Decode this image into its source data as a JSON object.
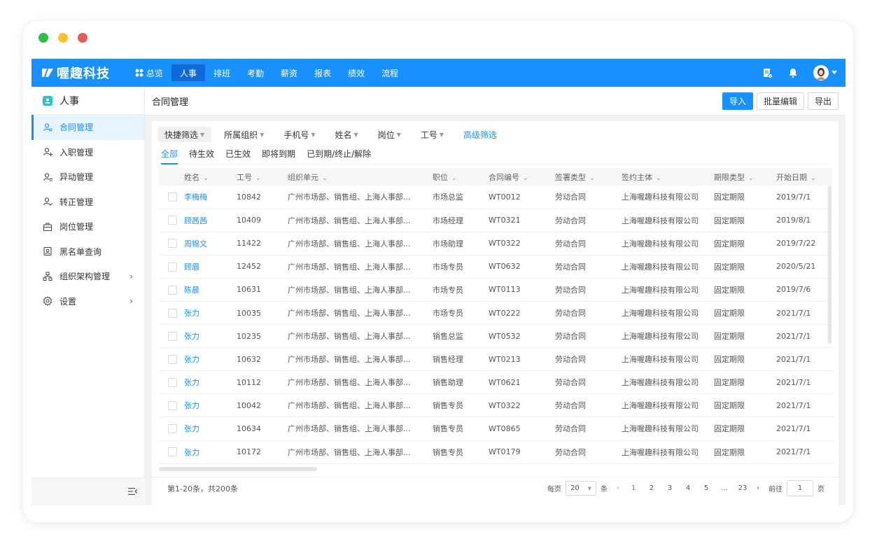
{
  "window": {
    "traffic_lights": [
      {
        "name": "close",
        "color": "#2dbf43"
      },
      {
        "name": "minimize",
        "color": "#f9c12e"
      },
      {
        "name": "zoom",
        "color": "#e45c5a"
      }
    ]
  },
  "topnav": {
    "brand": "喔趣科技",
    "items": [
      {
        "label": "总览",
        "icon": "grid-icon",
        "active": false
      },
      {
        "label": "人事",
        "active": true
      },
      {
        "label": "排班",
        "active": false
      },
      {
        "label": "考勤",
        "active": false
      },
      {
        "label": "薪资",
        "active": false
      },
      {
        "label": "报表",
        "active": false
      },
      {
        "label": "绩效",
        "active": false
      },
      {
        "label": "流程",
        "active": false
      }
    ],
    "right_icons": [
      "document-settings-icon",
      "bell-icon",
      "avatar",
      "caret-down-icon"
    ]
  },
  "sidebar": {
    "title": "人事",
    "items": [
      {
        "label": "合同管理",
        "icon": "user-contract-icon",
        "active": true
      },
      {
        "label": "入职管理",
        "icon": "user-add-icon",
        "active": false
      },
      {
        "label": "异动管理",
        "icon": "user-transfer-icon",
        "active": false
      },
      {
        "label": "转正管理",
        "icon": "user-check-icon",
        "active": false
      },
      {
        "label": "岗位管理",
        "icon": "briefcase-icon",
        "active": false
      },
      {
        "label": "黑名单查询",
        "icon": "blacklist-icon",
        "active": false
      },
      {
        "label": "组织架构管理",
        "icon": "org-chart-icon",
        "active": false,
        "has_children": true
      },
      {
        "label": "设置",
        "icon": "gear-icon",
        "active": false,
        "has_children": true
      }
    ]
  },
  "page": {
    "title": "合同管理",
    "actions": {
      "import": "导入",
      "batch_edit": "批量编辑",
      "export": "导出"
    }
  },
  "filters": [
    "快捷筛选",
    "所属组织",
    "手机号",
    "姓名",
    "岗位",
    "工号"
  ],
  "advanced_filter": "高级筛选",
  "status_tabs": [
    "全部",
    "待生效",
    "已生效",
    "即将到期",
    "已到期/终止/解除"
  ],
  "active_status_tab": "全部",
  "table": {
    "columns": [
      "姓名",
      "工号",
      "组织单元",
      "职位",
      "合同编号",
      "签署类型",
      "签约主体",
      "期限类型",
      "开始日期"
    ],
    "rows": [
      [
        "李梅梅",
        "10842",
        "广州市场部、销售组、上海人事部...",
        "市场总监",
        "WT0012",
        "劳动合同",
        "上海喔趣科技有限公司",
        "固定期限",
        "2019/7/1"
      ],
      [
        "顾茜茜",
        "10409",
        "广州市场部、销售组、上海人事部...",
        "市场经理",
        "WT0321",
        "劳动合同",
        "上海喔趣科技有限公司",
        "固定期限",
        "2019/8/1"
      ],
      [
        "周锡文",
        "11422",
        "广州市场部、销售组、上海人事部...",
        "市场助理",
        "WT0322",
        "劳动合同",
        "上海喔趣科技有限公司",
        "固定期限",
        "2019/7/22"
      ],
      [
        "顾眉",
        "12452",
        "广州市场部、销售组、上海人事部...",
        "市场专员",
        "WT0632",
        "劳动合同",
        "上海喔趣科技有限公司",
        "固定期限",
        "2020/5/21"
      ],
      [
        "陈晨",
        "10631",
        "广州市场部、销售组、上海人事部...",
        "市场专员",
        "WT0113",
        "劳动合同",
        "上海喔趣科技有限公司",
        "固定期限",
        "2019/7/6"
      ],
      [
        "张力",
        "10035",
        "广州市场部、销售组、上海人事部...",
        "市场专员",
        "WT0222",
        "劳动合同",
        "上海喔趣科技有限公司",
        "固定期限",
        "2021/7/1"
      ],
      [
        "张力",
        "10235",
        "广州市场部、销售组、上海人事部...",
        "销售总监",
        "WT0532",
        "劳动合同",
        "上海喔趣科技有限公司",
        "固定期限",
        "2021/7/1"
      ],
      [
        "张力",
        "10632",
        "广州市场部、销售组、上海人事部...",
        "销售经理",
        "WT0213",
        "劳动合同",
        "上海喔趣科技有限公司",
        "固定期限",
        "2021/7/1"
      ],
      [
        "张力",
        "10112",
        "广州市场部、销售组、上海人事部...",
        "销售助理",
        "WT0621",
        "劳动合同",
        "上海喔趣科技有限公司",
        "固定期限",
        "2021/7/1"
      ],
      [
        "张力",
        "10042",
        "广州市场部、销售组、上海人事部...",
        "销售专员",
        "WT0322",
        "劳动合同",
        "上海喔趣科技有限公司",
        "固定期限",
        "2021/7/1"
      ],
      [
        "张力",
        "10634",
        "广州市场部、销售组、上海人事部...",
        "销售专员",
        "WT0865",
        "劳动合同",
        "上海喔趣科技有限公司",
        "固定期限",
        "2021/7/1"
      ],
      [
        "张力",
        "10172",
        "广州市场部、销售组、上海人事部...",
        "销售专员",
        "WT0179",
        "劳动合同",
        "上海喔趣科技有限公司",
        "固定期限",
        "2021/7/1"
      ]
    ]
  },
  "pagination": {
    "total_text": "第1-20条，共200条",
    "per_page_label": "每页",
    "per_page_value": "20",
    "per_page_unit": "条",
    "pages": [
      "1",
      "2",
      "3",
      "4",
      "5",
      "...",
      "23"
    ],
    "current_page": "1",
    "goto_label": "前往",
    "goto_value": "1",
    "goto_unit": "页"
  }
}
